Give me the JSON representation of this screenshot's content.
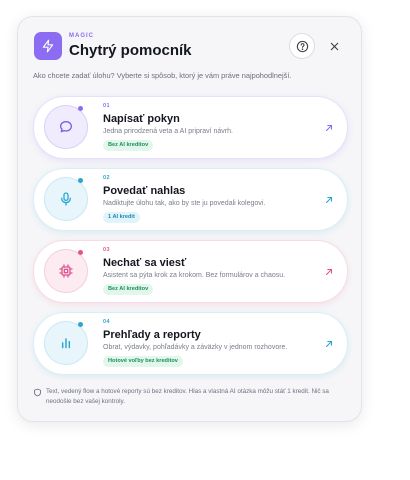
{
  "header": {
    "eyebrow": "MAGIC",
    "title": "Chytrý pomocník",
    "icons": {
      "logo": "lightning-icon",
      "help": "question-icon",
      "close": "close-icon"
    },
    "accent": "#8b6cf2"
  },
  "subtitle": "Ako chcete zadať úlohu? Vyberte si spôsob, ktorý je vám práve najpohodlnejší.",
  "options": [
    {
      "number": "01",
      "title": "Napísať pokyn",
      "description": "Jedna prirodzená veta a AI pripraví návrh.",
      "badge": "Bez AI kreditov",
      "icon": "chat-bubble-icon",
      "accent": "#8b6cf2"
    },
    {
      "number": "02",
      "title": "Povedať nahlas",
      "description": "Nadiktujte úlohu tak, ako by ste ju povedali kolegovi.",
      "badge": "1 AI kredit",
      "icon": "microphone-icon",
      "accent": "#2ba6cf"
    },
    {
      "number": "03",
      "title": "Nechať sa viesť",
      "description": "Asistent sa pýta krok za krokom. Bez formulárov a chaosu.",
      "badge": "Bez AI kreditov",
      "icon": "chip-icon",
      "accent": "#e0558e"
    },
    {
      "number": "04",
      "title": "Prehľady a reporty",
      "description": "Obrat, výdavky, pohľadávky a záväzky v jednom rozhovore.",
      "badge": "Hotové voľby bez kreditov",
      "icon": "bar-chart-icon",
      "accent": "#2ba6cf"
    }
  ],
  "footer": {
    "icon": "shield-icon",
    "text": "Text, vedený flow a hotové reporty sú bez kreditov. Hlas a vlastná AI otázka môžu stáť 1 kredit. Nič sa neodošle bez vašej kontroly."
  }
}
